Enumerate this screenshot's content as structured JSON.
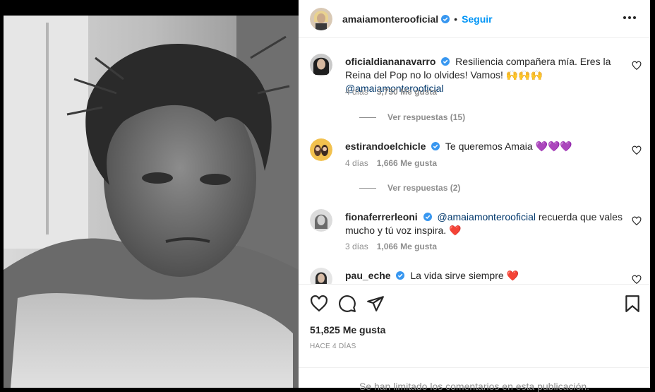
{
  "post": {
    "author": "amaiamonterooficial",
    "separator": "•",
    "follow_label": "Seguir"
  },
  "comments": [
    {
      "user": "oficialdiananavarro",
      "text": "Resiliencia compañera mía. Eres la Reina del Pop no lo olvides! Vamos! 🙌🙌🙌",
      "mention": "@amaiamonterooficial",
      "time": "4 días",
      "likes": "3,730 Me gusta",
      "replies": "Ver respuestas (15)"
    },
    {
      "user": "estirandoelchicle",
      "text": "Te queremos Amaia 💜💜💜",
      "time": "4 días",
      "likes": "1,666 Me gusta",
      "replies": "Ver respuestas (2)"
    },
    {
      "user": "fionaferrerleoni",
      "mention": "@amaiamonterooficial",
      "text": "recuerda que vales mucho y tú voz inspira. ❤️",
      "time": "3 días",
      "likes": "1,066 Me gusta"
    },
    {
      "user": "pau_eche",
      "text": "La vida sirve siempre ❤️"
    }
  ],
  "footer": {
    "likes": "51,825 Me gusta",
    "time_ago": "HACE 4 DÍAS",
    "limited_notice": "Se han limitado los comentarios en esta publicación."
  },
  "colors": {
    "accent": "#0095f6",
    "verified": "#3897f0",
    "mention": "#00376b",
    "muted": "#8e8e8e"
  },
  "icons": [
    "verified-icon",
    "more-options-icon",
    "heart-icon",
    "comment-icon",
    "share-icon",
    "save-icon"
  ]
}
